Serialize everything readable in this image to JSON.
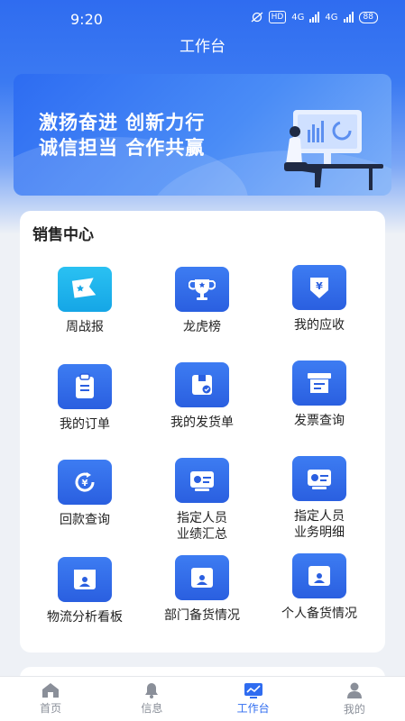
{
  "status_bar": {
    "time": "9:20",
    "hd": "HD",
    "net1": "4G",
    "net2": "4G",
    "battery": "88"
  },
  "header": {
    "title": "工作台"
  },
  "banner": {
    "line1": "激扬奋进 创新力行",
    "line2": "诚信担当 合作共赢"
  },
  "sales_center": {
    "title": "销售中心",
    "items": [
      {
        "label": "周战报",
        "icon": "flag-icon"
      },
      {
        "label": "龙虎榜",
        "icon": "trophy-icon"
      },
      {
        "label": "我的应收",
        "icon": "yuan-receivable-icon"
      },
      {
        "label": "我的订单",
        "icon": "clipboard-icon"
      },
      {
        "label": "我的发货单",
        "icon": "delivery-box-icon"
      },
      {
        "label": "发票查询",
        "icon": "invoice-icon"
      },
      {
        "label": "回款查询",
        "icon": "yuan-refresh-icon"
      },
      {
        "label": "指定人员\n业绩汇总",
        "icon": "performance-card-icon"
      },
      {
        "label": "指定人员\n业务明细",
        "icon": "business-card-icon"
      },
      {
        "label": "物流分析看板",
        "icon": "logistics-board-icon"
      },
      {
        "label": "部门备货情况",
        "icon": "dept-stock-icon"
      },
      {
        "label": "个人备货情况",
        "icon": "personal-stock-icon"
      }
    ]
  },
  "tabbar": {
    "items": [
      {
        "label": "首页",
        "icon": "home-icon"
      },
      {
        "label": "信息",
        "icon": "bell-icon"
      },
      {
        "label": "工作台",
        "icon": "workbench-chart-icon"
      },
      {
        "label": "我的",
        "icon": "user-icon"
      }
    ],
    "active_index": 2
  },
  "colors": {
    "primary": "#2f6cf0",
    "icon_blue": "#2a5fe0",
    "icon_cyan": "#15a6e6",
    "tab_inactive": "#8a8f99"
  }
}
